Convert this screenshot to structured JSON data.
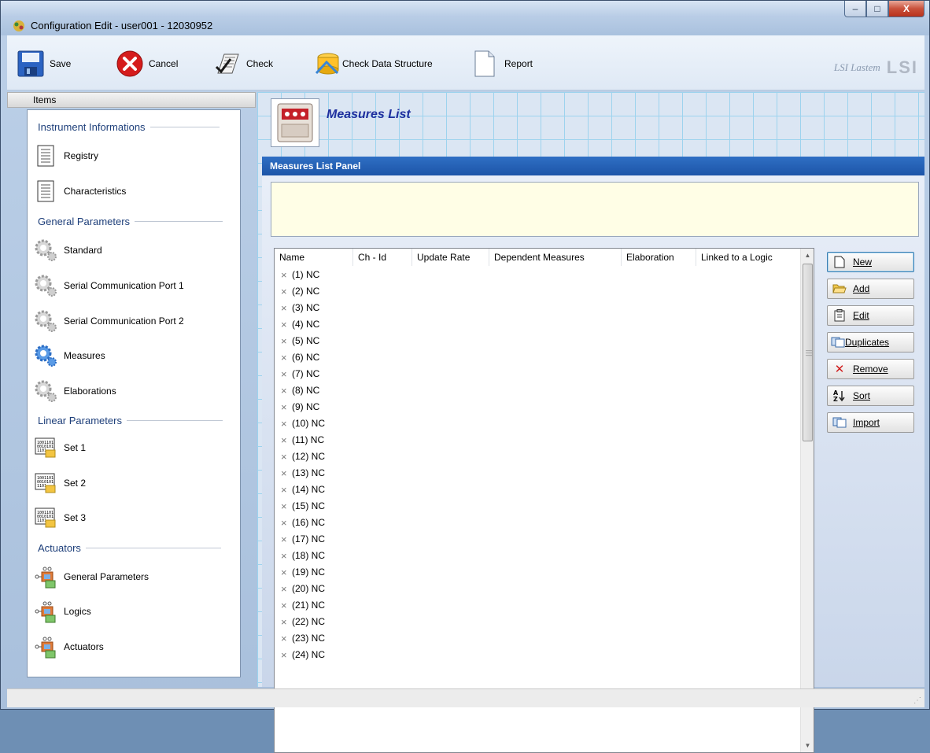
{
  "window": {
    "title": "Configuration Edit - user001 - 12030952",
    "minimize": "–",
    "maximize": "□",
    "close": "X"
  },
  "toolbar": {
    "save_label": "Save",
    "cancel_label": "Cancel",
    "check_label": "Check",
    "check_data_structure_label": "Check Data Structure",
    "report_label": "Report",
    "brand_text": "LSI Lastem",
    "brand_logo": "LSI"
  },
  "sidebar": {
    "header": "Items",
    "groups": [
      {
        "title": "Instrument Informations",
        "items": [
          {
            "label": "Registry",
            "icon": "document-icon"
          },
          {
            "label": "Characteristics",
            "icon": "document-icon"
          }
        ]
      },
      {
        "title": "General Parameters",
        "items": [
          {
            "label": "Standard",
            "icon": "gear-icon"
          },
          {
            "label": "Serial Communication Port 1",
            "icon": "gear-icon"
          },
          {
            "label": "Serial Communication Port 2",
            "icon": "gear-icon"
          },
          {
            "label": "Measures",
            "icon": "gear-icon-active"
          },
          {
            "label": "Elaborations",
            "icon": "gear-icon"
          }
        ]
      },
      {
        "title": "Linear Parameters",
        "items": [
          {
            "label": "Set 1",
            "icon": "binary-folder-icon"
          },
          {
            "label": "Set 2",
            "icon": "binary-folder-icon"
          },
          {
            "label": "Set 3",
            "icon": "binary-folder-icon"
          }
        ]
      },
      {
        "title": "Actuators",
        "items": [
          {
            "label": "General Parameters",
            "icon": "actuator-icon"
          },
          {
            "label": "Logics",
            "icon": "actuator-icon"
          },
          {
            "label": "Actuators",
            "icon": "actuator-icon"
          }
        ]
      }
    ]
  },
  "main": {
    "title": "Measures List",
    "panel_title": "Measures List Panel",
    "columns": [
      "Name",
      "Ch - Id",
      "Update Rate",
      "Dependent Measures",
      "Elaboration",
      "Linked to a Logic"
    ],
    "rows": [
      "(1) NC",
      "(2) NC",
      "(3) NC",
      "(4) NC",
      "(5) NC",
      "(6) NC",
      "(7) NC",
      "(8) NC",
      "(9) NC",
      "(10) NC",
      "(11) NC",
      "(12) NC",
      "(13) NC",
      "(14) NC",
      "(15) NC",
      "(16) NC",
      "(17) NC",
      "(18) NC",
      "(19) NC",
      "(20) NC",
      "(21) NC",
      "(22) NC",
      "(23) NC",
      "(24) NC"
    ],
    "buttons": {
      "new": "New",
      "add": "Add",
      "edit": "Edit",
      "duplicates": "Duplicates",
      "remove": "Remove",
      "sort": "Sort",
      "import": "Import"
    }
  },
  "colors": {
    "panel_bar": "#1d55a8",
    "title_blue": "#1f2f9e",
    "info_box": "#fffee6",
    "grid_lines": "#9dd3ee"
  }
}
